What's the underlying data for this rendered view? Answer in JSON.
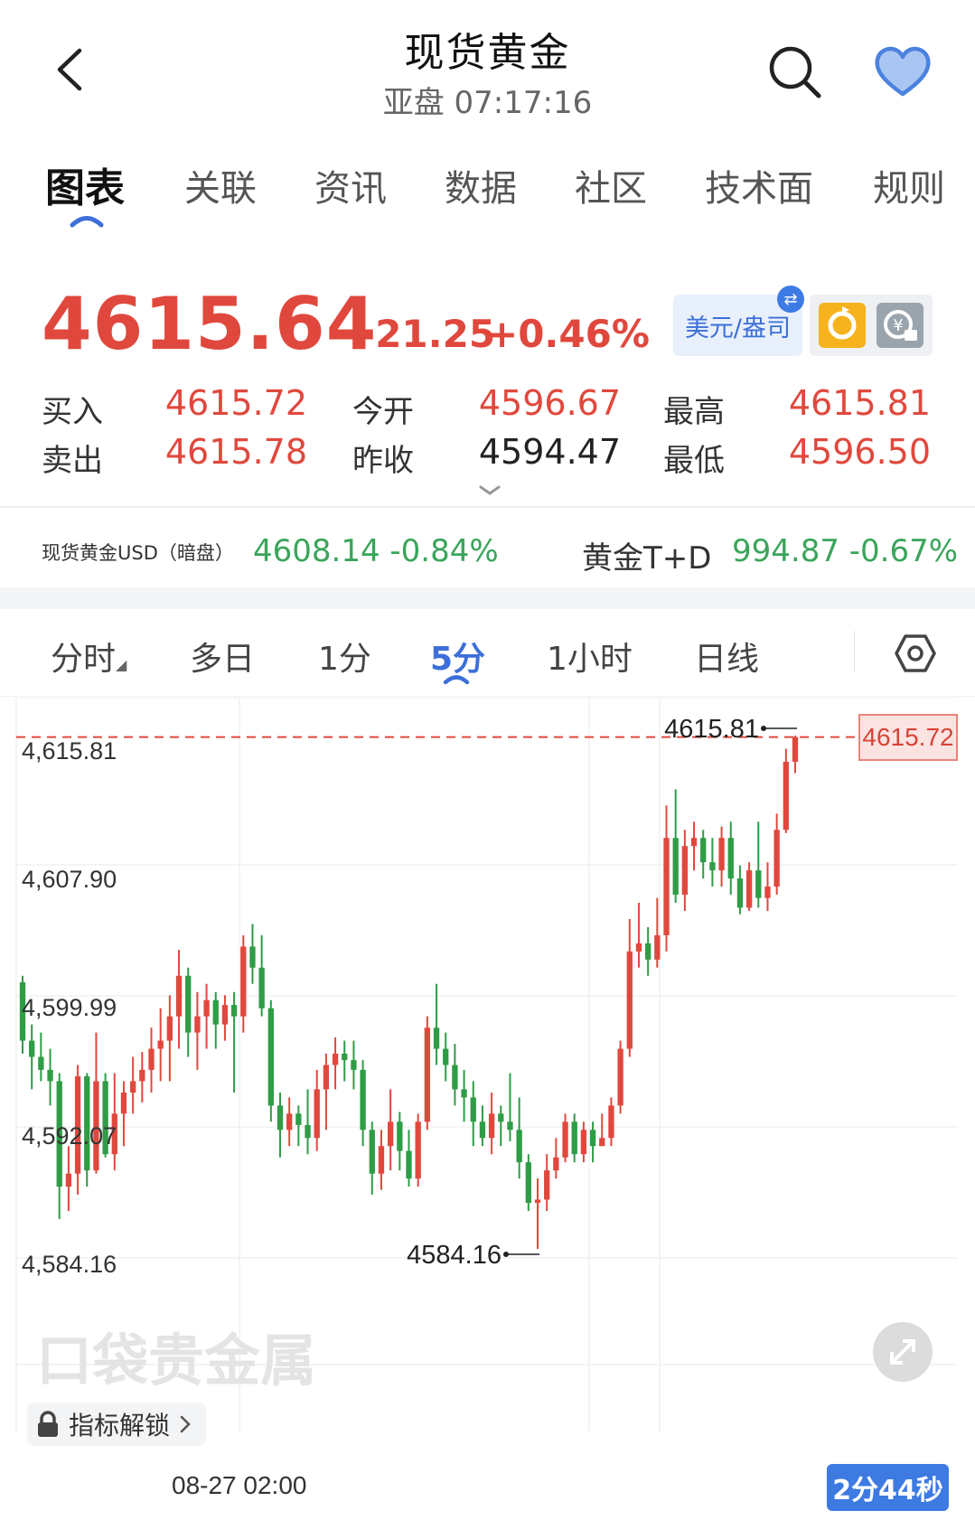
{
  "header": {
    "title": "现货黄金",
    "subtitle": "亚盘  07:17:16"
  },
  "tabs": [
    {
      "label": "图表",
      "active": true
    },
    {
      "label": "关联"
    },
    {
      "label": "资讯"
    },
    {
      "label": "数据"
    },
    {
      "label": "社区"
    },
    {
      "label": "技术面"
    },
    {
      "label": "规则"
    }
  ],
  "quote": {
    "price": "4615.64",
    "change": "+21.25",
    "change_pct": "+0.46%",
    "unit_label": "美元/盎司",
    "rows": [
      [
        {
          "label": "买入",
          "value": "4615.72"
        },
        {
          "label": "今开",
          "value": "4596.67"
        },
        {
          "label": "最高",
          "value": "4615.81"
        }
      ],
      [
        {
          "label": "卖出",
          "value": "4615.78"
        },
        {
          "label": "昨收",
          "value": "4594.47"
        },
        {
          "label": "最低",
          "value": "4596.50"
        }
      ]
    ]
  },
  "related": [
    {
      "label": "现货黄金USD（暗盘）",
      "value": "4608.14 -0.84%"
    },
    {
      "label": "黄金T+D",
      "value": "994.87 -0.67%"
    }
  ],
  "period_tabs": [
    {
      "label": "分时"
    },
    {
      "label": "多日"
    },
    {
      "label": "1分"
    },
    {
      "label": "5分",
      "active": true
    },
    {
      "label": "1小时"
    },
    {
      "label": "日线"
    }
  ],
  "chart": {
    "current_tag": "4615.72",
    "high_label": "4615.81",
    "low_label": "4584.16",
    "watermark": "口袋贵金属",
    "x_label": "08-27 02:00",
    "indicator_button": "指标解锁",
    "timer": "2分44秒"
  },
  "colors": {
    "up": "#e0483d",
    "down": "#2f9c46",
    "accent": "#3c6fd8"
  },
  "chart_data": {
    "type": "candlestick",
    "y_ticks": [
      "4,615.81",
      "4,607.90",
      "4,599.99",
      "4,592.07",
      "4,584.16"
    ],
    "ylim": [
      4582.0,
      4617.5
    ],
    "current_price": 4615.72,
    "high": 4615.81,
    "low": 4584.16,
    "x_tick_labels": [
      "08-27 02:00"
    ],
    "candles": [
      {
        "o": 4600.6,
        "c": 4597.0,
        "h": 4601.0,
        "l": 4596.2
      },
      {
        "o": 4597.0,
        "c": 4596.0,
        "h": 4598.0,
        "l": 4594.0
      },
      {
        "o": 4596.0,
        "c": 4595.2,
        "h": 4597.5,
        "l": 4594.5
      },
      {
        "o": 4595.2,
        "c": 4594.5,
        "h": 4596.5,
        "l": 4593.0
      },
      {
        "o": 4594.5,
        "c": 4588.0,
        "h": 4595.0,
        "l": 4586.0
      },
      {
        "o": 4588.0,
        "c": 4588.8,
        "h": 4590.5,
        "l": 4586.5
      },
      {
        "o": 4588.8,
        "c": 4594.8,
        "h": 4595.5,
        "l": 4587.5
      },
      {
        "o": 4594.8,
        "c": 4589.0,
        "h": 4595.0,
        "l": 4588.0
      },
      {
        "o": 4589.0,
        "c": 4594.5,
        "h": 4597.5,
        "l": 4588.8
      },
      {
        "o": 4594.5,
        "c": 4590.0,
        "h": 4595.0,
        "l": 4589.8
      },
      {
        "o": 4590.0,
        "c": 4592.5,
        "h": 4595.0,
        "l": 4589.0
      },
      {
        "o": 4592.5,
        "c": 4593.8,
        "h": 4594.5,
        "l": 4590.5
      },
      {
        "o": 4593.8,
        "c": 4594.5,
        "h": 4596.0,
        "l": 4592.5
      },
      {
        "o": 4594.5,
        "c": 4595.2,
        "h": 4596.3,
        "l": 4593.2
      },
      {
        "o": 4595.2,
        "c": 4596.5,
        "h": 4597.8,
        "l": 4593.8
      },
      {
        "o": 4596.5,
        "c": 4597.0,
        "h": 4599.0,
        "l": 4594.5
      },
      {
        "o": 4597.0,
        "c": 4598.5,
        "h": 4599.8,
        "l": 4594.5
      },
      {
        "o": 4598.5,
        "c": 4601.0,
        "h": 4602.6,
        "l": 4596.5
      },
      {
        "o": 4601.0,
        "c": 4597.5,
        "h": 4601.5,
        "l": 4596.0
      },
      {
        "o": 4597.5,
        "c": 4598.5,
        "h": 4600.0,
        "l": 4595.2
      },
      {
        "o": 4598.5,
        "c": 4599.5,
        "h": 4600.5,
        "l": 4596.5
      },
      {
        "o": 4599.5,
        "c": 4598.0,
        "h": 4600.0,
        "l": 4596.5
      },
      {
        "o": 4598.0,
        "c": 4599.2,
        "h": 4599.8,
        "l": 4597.0
      },
      {
        "o": 4599.2,
        "c": 4598.5,
        "h": 4600.0,
        "l": 4593.8
      },
      {
        "o": 4598.5,
        "c": 4602.8,
        "h": 4603.5,
        "l": 4597.5
      },
      {
        "o": 4602.8,
        "c": 4601.5,
        "h": 4604.2,
        "l": 4600.5
      },
      {
        "o": 4601.5,
        "c": 4599.0,
        "h": 4603.5,
        "l": 4598.5
      },
      {
        "o": 4599.0,
        "c": 4593.0,
        "h": 4599.5,
        "l": 4592.0
      },
      {
        "o": 4593.0,
        "c": 4591.5,
        "h": 4593.8,
        "l": 4589.8
      },
      {
        "o": 4591.5,
        "c": 4592.5,
        "h": 4593.5,
        "l": 4590.5
      },
      {
        "o": 4592.5,
        "c": 4591.8,
        "h": 4593.0,
        "l": 4590.5
      },
      {
        "o": 4591.8,
        "c": 4591.0,
        "h": 4594.0,
        "l": 4590.0
      },
      {
        "o": 4591.0,
        "c": 4594.0,
        "h": 4595.2,
        "l": 4590.2
      },
      {
        "o": 4594.0,
        "c": 4595.5,
        "h": 4596.2,
        "l": 4591.5
      },
      {
        "o": 4595.5,
        "c": 4596.2,
        "h": 4597.2,
        "l": 4594.0
      },
      {
        "o": 4596.2,
        "c": 4595.8,
        "h": 4597.0,
        "l": 4594.5
      },
      {
        "o": 4595.8,
        "c": 4595.2,
        "h": 4597.0,
        "l": 4594.0
      },
      {
        "o": 4595.2,
        "c": 4591.5,
        "h": 4595.8,
        "l": 4590.5
      },
      {
        "o": 4591.5,
        "c": 4588.8,
        "h": 4592.0,
        "l": 4587.5
      },
      {
        "o": 4588.8,
        "c": 4590.5,
        "h": 4591.5,
        "l": 4587.8
      },
      {
        "o": 4590.5,
        "c": 4592.0,
        "h": 4594.0,
        "l": 4589.0
      },
      {
        "o": 4592.0,
        "c": 4590.2,
        "h": 4592.6,
        "l": 4589.0
      },
      {
        "o": 4590.2,
        "c": 4588.5,
        "h": 4591.5,
        "l": 4588.0
      },
      {
        "o": 4588.5,
        "c": 4592.0,
        "h": 4592.5,
        "l": 4588.0
      },
      {
        "o": 4592.0,
        "c": 4597.8,
        "h": 4598.5,
        "l": 4591.5
      },
      {
        "o": 4597.8,
        "c": 4596.5,
        "h": 4600.5,
        "l": 4595.5
      },
      {
        "o": 4596.5,
        "c": 4595.5,
        "h": 4597.5,
        "l": 4594.5
      },
      {
        "o": 4595.5,
        "c": 4594.0,
        "h": 4596.8,
        "l": 4593.0
      },
      {
        "o": 4594.0,
        "c": 4593.5,
        "h": 4595.2,
        "l": 4592.0
      },
      {
        "o": 4593.5,
        "c": 4592.0,
        "h": 4594.5,
        "l": 4590.5
      },
      {
        "o": 4592.0,
        "c": 4591.0,
        "h": 4593.0,
        "l": 4590.5
      },
      {
        "o": 4591.0,
        "c": 4592.5,
        "h": 4593.8,
        "l": 4590.0
      },
      {
        "o": 4592.5,
        "c": 4592.0,
        "h": 4593.0,
        "l": 4590.5
      },
      {
        "o": 4592.0,
        "c": 4591.5,
        "h": 4595.0,
        "l": 4590.8
      },
      {
        "o": 4591.5,
        "c": 4589.5,
        "h": 4593.5,
        "l": 4588.5
      },
      {
        "o": 4589.5,
        "c": 4587.0,
        "h": 4590.0,
        "l": 4586.5
      },
      {
        "o": 4587.0,
        "c": 4587.2,
        "h": 4588.5,
        "l": 4584.16
      },
      {
        "o": 4587.2,
        "c": 4589.0,
        "h": 4590.0,
        "l": 4586.5
      },
      {
        "o": 4589.0,
        "c": 4589.8,
        "h": 4591.0,
        "l": 4588.5
      },
      {
        "o": 4589.8,
        "c": 4592.0,
        "h": 4592.5,
        "l": 4589.5
      },
      {
        "o": 4592.0,
        "c": 4590.0,
        "h": 4592.5,
        "l": 4589.5
      },
      {
        "o": 4590.0,
        "c": 4591.5,
        "h": 4592.0,
        "l": 4589.5
      },
      {
        "o": 4591.5,
        "c": 4590.5,
        "h": 4592.0,
        "l": 4589.5
      },
      {
        "o": 4590.5,
        "c": 4591.0,
        "h": 4592.5,
        "l": 4590.5
      },
      {
        "o": 4591.0,
        "c": 4593.0,
        "h": 4593.5,
        "l": 4590.5
      },
      {
        "o": 4593.0,
        "c": 4596.5,
        "h": 4597.0,
        "l": 4592.5
      },
      {
        "o": 4596.5,
        "c": 4602.5,
        "h": 4604.5,
        "l": 4596.0
      },
      {
        "o": 4602.5,
        "c": 4603.0,
        "h": 4605.5,
        "l": 4601.5
      },
      {
        "o": 4603.0,
        "c": 4602.0,
        "h": 4604.0,
        "l": 4601.0
      },
      {
        "o": 4602.0,
        "c": 4603.5,
        "h": 4605.8,
        "l": 4601.5
      },
      {
        "o": 4603.5,
        "c": 4609.5,
        "h": 4611.5,
        "l": 4602.5
      },
      {
        "o": 4609.5,
        "c": 4606.0,
        "h": 4612.5,
        "l": 4605.5
      },
      {
        "o": 4606.0,
        "c": 4609.0,
        "h": 4610.0,
        "l": 4605.0
      },
      {
        "o": 4609.0,
        "c": 4609.5,
        "h": 4610.5,
        "l": 4607.5
      },
      {
        "o": 4609.5,
        "c": 4608.0,
        "h": 4610.0,
        "l": 4607.0
      },
      {
        "o": 4608.0,
        "c": 4607.5,
        "h": 4609.5,
        "l": 4606.5
      },
      {
        "o": 4607.5,
        "c": 4609.5,
        "h": 4610.2,
        "l": 4606.5
      },
      {
        "o": 4609.5,
        "c": 4607.0,
        "h": 4610.5,
        "l": 4606.0
      },
      {
        "o": 4607.0,
        "c": 4605.2,
        "h": 4607.8,
        "l": 4604.8
      },
      {
        "o": 4605.2,
        "c": 4607.5,
        "h": 4608.0,
        "l": 4605.0
      },
      {
        "o": 4607.5,
        "c": 4605.8,
        "h": 4610.5,
        "l": 4605.2
      },
      {
        "o": 4605.8,
        "c": 4606.5,
        "h": 4608.0,
        "l": 4605.0
      },
      {
        "o": 4606.5,
        "c": 4610.0,
        "h": 4611.0,
        "l": 4606.0
      },
      {
        "o": 4610.0,
        "c": 4614.2,
        "h": 4615.0,
        "l": 4609.8
      },
      {
        "o": 4614.2,
        "c": 4615.72,
        "h": 4615.81,
        "l": 4613.5
      }
    ]
  }
}
